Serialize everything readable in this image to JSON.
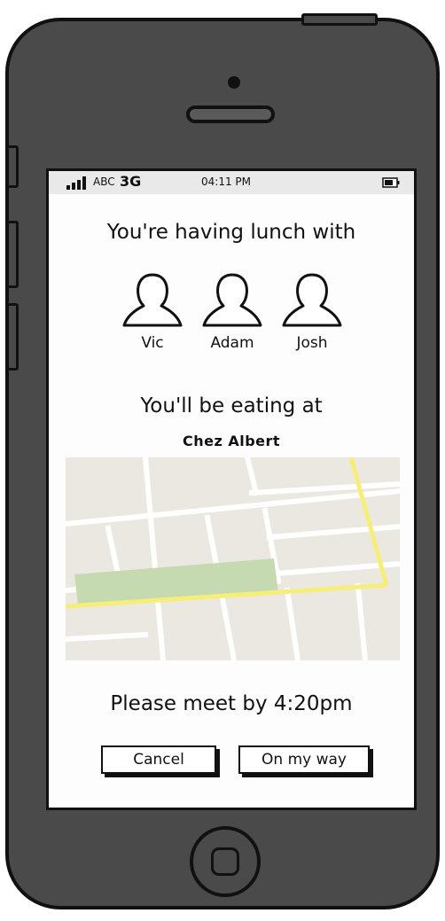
{
  "status_bar": {
    "carrier": "ABC",
    "network": "3G",
    "time": "04:11 PM"
  },
  "lunch": {
    "heading": "You're having lunch with",
    "friends": [
      {
        "name": "Vic"
      },
      {
        "name": "Adam"
      },
      {
        "name": "Josh"
      }
    ]
  },
  "location": {
    "heading": "You'll be eating at",
    "restaurant": "Chez Albert"
  },
  "meeting": {
    "text": "Please meet by 4:20pm"
  },
  "actions": {
    "cancel_label": "Cancel",
    "on_my_way_label": "On my way"
  },
  "colors": {
    "phone_body": "#4a4a4a",
    "screen": "#fdfdfd",
    "map_background": "#ebe8e1",
    "map_park": "#c5dab0",
    "map_highway": "#f7ee7a"
  }
}
